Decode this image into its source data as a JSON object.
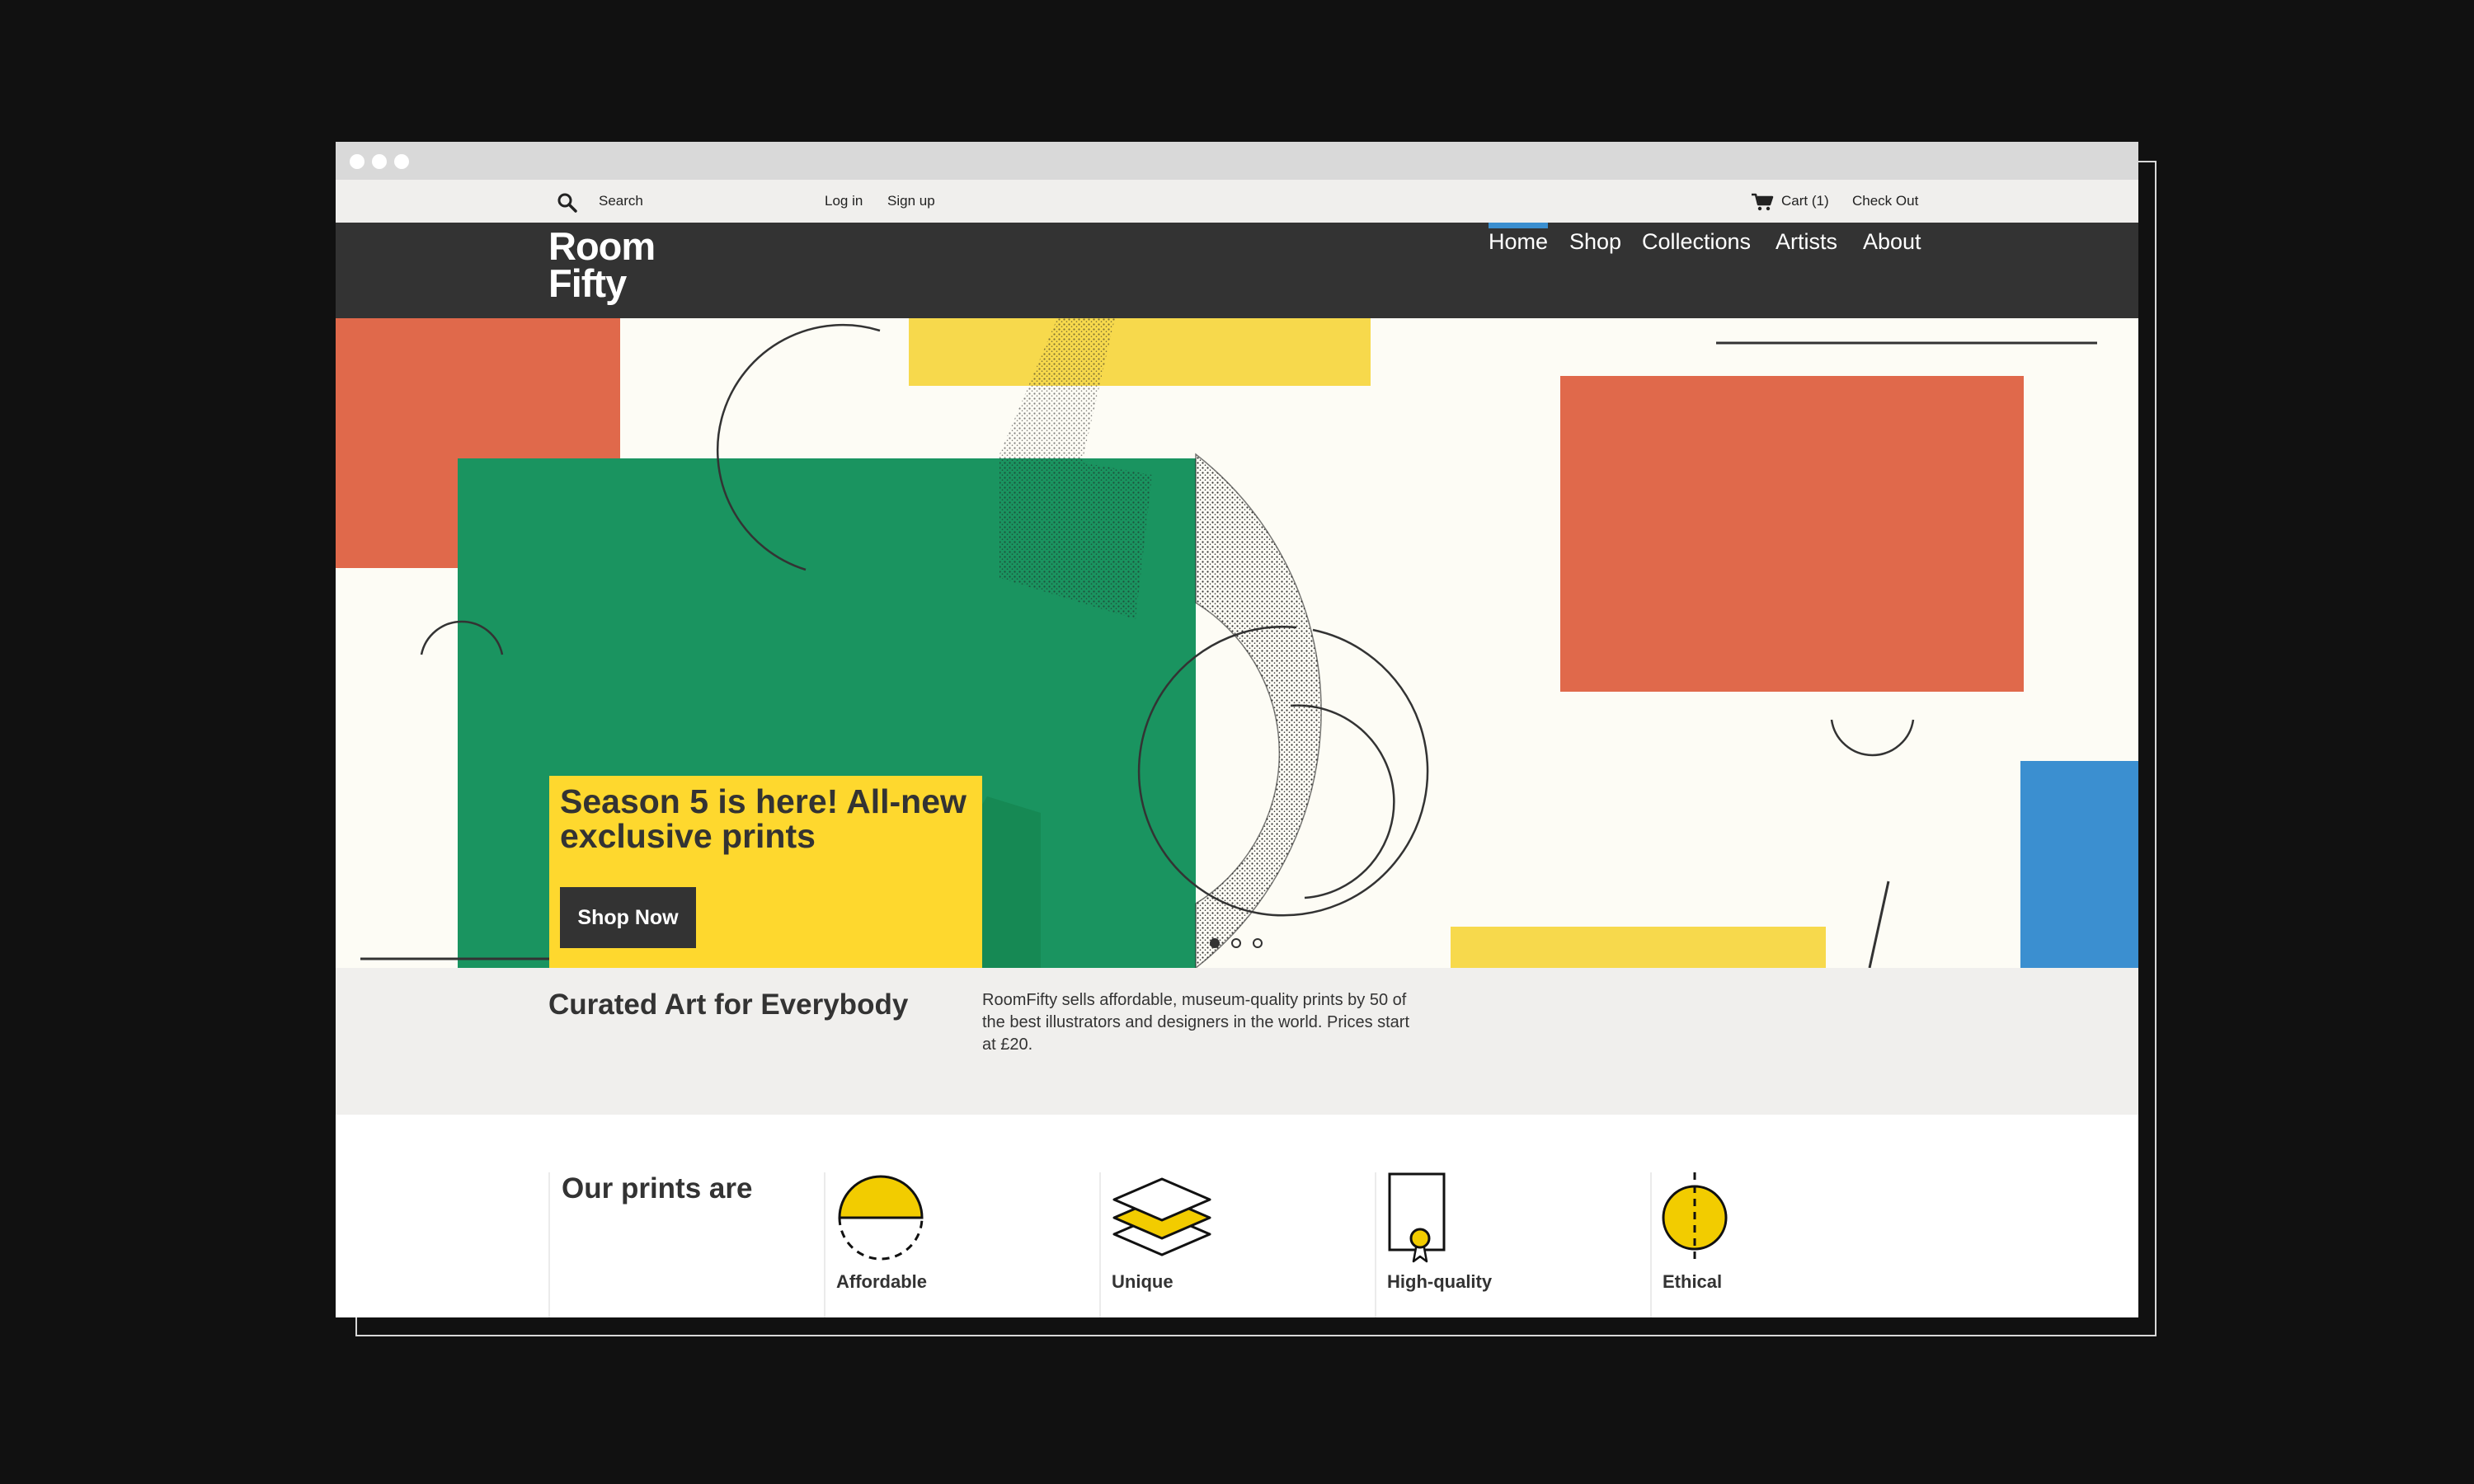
{
  "util": {
    "search_placeholder": "Search",
    "login": "Log in",
    "signup": "Sign up",
    "cart": "Cart (1)",
    "checkout": "Check Out"
  },
  "brand": {
    "line1": "Room",
    "line2": "Fifty"
  },
  "nav": {
    "items": [
      {
        "label": "Home",
        "active": true
      },
      {
        "label": "Shop"
      },
      {
        "label": "Collections"
      },
      {
        "label": "Artists"
      },
      {
        "label": "About"
      }
    ]
  },
  "hero": {
    "headline": "Season 5 is here! All-new exclusive prints",
    "cta": "Shop Now",
    "slides": 3,
    "active_slide": 1
  },
  "intro": {
    "title": "Curated Art for Everybody",
    "text": "RoomFifty sells affordable, museum-quality prints by 50 of the best illustrators and designers in the world. Prices start at £20."
  },
  "features": {
    "heading": "Our prints are",
    "items": [
      {
        "label": "Affordable",
        "icon": "half-circle-icon"
      },
      {
        "label": "Unique",
        "icon": "stacked-layers-icon"
      },
      {
        "label": "High-quality",
        "icon": "certificate-icon"
      },
      {
        "label": "Ethical",
        "icon": "balanced-circle-icon"
      }
    ]
  },
  "colors": {
    "dark": "#333333",
    "accent_blue": "#3b8fd0",
    "yellow": "#fed82e",
    "green": "#1a9460",
    "red": "#e0694b",
    "cream": "#fdfcf5"
  }
}
